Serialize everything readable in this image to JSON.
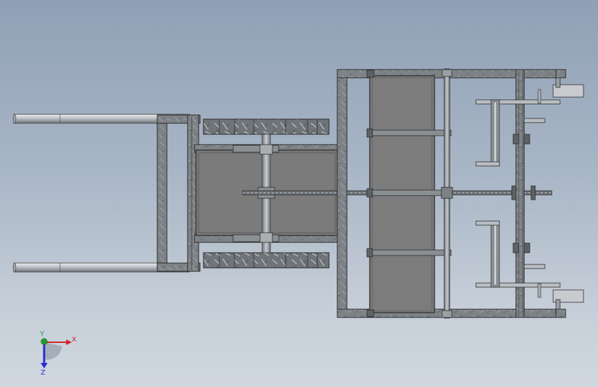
{
  "viewport": {
    "background_top": "#8fa0b6",
    "background_bottom": "#d0d7df"
  },
  "model": {
    "frame_color": "#7f8487",
    "plate_color": "#7a7a7a",
    "tube_color": "#b9bec2",
    "outline_color": "#2a2a2a"
  },
  "triad": {
    "x_label": "X",
    "y_label": "Y",
    "z_label": "Z",
    "x_color": "#d22222",
    "y_color": "#1f9e2a",
    "z_color": "#2b2bd0"
  }
}
